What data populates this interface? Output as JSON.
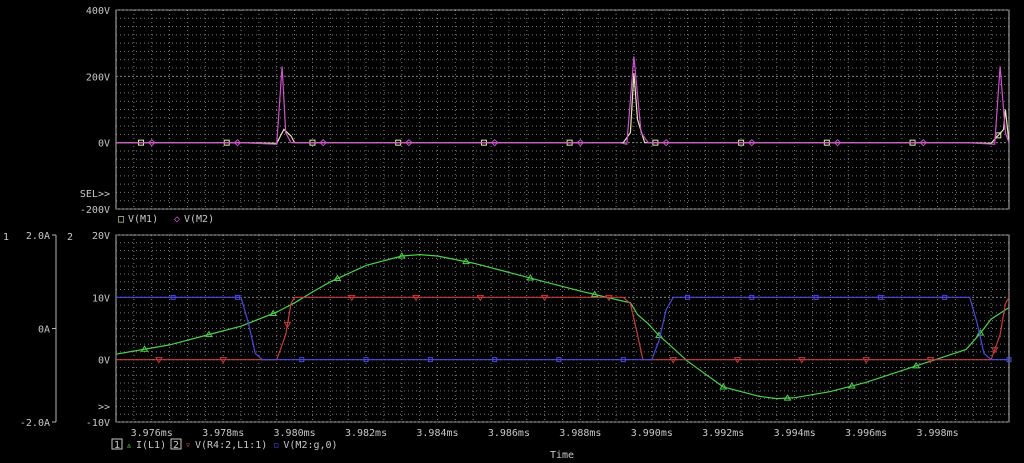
{
  "colors": {
    "background": "#000000",
    "frame": "#b4b4b4",
    "grid": "#7a7a7a",
    "text": "#c8c8c8",
    "v_m1": "#e8e6b0",
    "v_m2": "#d050d0",
    "i_l1": "#4cd04c",
    "v_r4": "#c83a3a",
    "v_m2g": "#4a4ae0"
  },
  "chart_data": [
    {
      "type": "line",
      "panel": "top",
      "x_range_ms": [
        3.975,
        4.0
      ],
      "ylim": [
        -200,
        400
      ],
      "y_ticks": [
        "400V",
        "200V",
        "0V",
        "-200V"
      ],
      "grid": true,
      "sel_marker": "SEL>>",
      "legend": [
        {
          "symbol": "□",
          "label": "V(M1)"
        },
        {
          "symbol": "◇",
          "label": "V(M2)"
        }
      ],
      "series": [
        {
          "name": "V(M1)",
          "x": [
            3.975,
            3.9785,
            3.9795,
            3.9797,
            3.9799,
            3.98,
            3.9892,
            3.9894,
            3.9895,
            3.9896,
            3.9898,
            3.9903,
            3.9988,
            3.9995,
            3.99985,
            3.9999,
            4.0
          ],
          "values": [
            0,
            0,
            -2,
            40,
            20,
            0,
            0,
            30,
            210,
            70,
            0,
            0,
            0,
            -2,
            40,
            100,
            0
          ]
        },
        {
          "name": "V(M2)",
          "x": [
            3.975,
            3.9785,
            3.9795,
            3.97965,
            3.97975,
            3.9799,
            3.98,
            3.9891,
            3.9893,
            3.9895,
            3.9897,
            3.9899,
            3.99,
            3.9988,
            3.9996,
            3.99975,
            3.9999,
            4.0
          ],
          "values": [
            0,
            0,
            -5,
            230,
            30,
            0,
            0,
            0,
            -5,
            260,
            30,
            0,
            0,
            0,
            -5,
            230,
            30,
            0
          ]
        }
      ]
    },
    {
      "type": "line",
      "panel": "bottom",
      "x_range_ms": [
        3.975,
        4.0
      ],
      "x_ticks": [
        "3.976ms",
        "3.978ms",
        "3.980ms",
        "3.982ms",
        "3.984ms",
        "3.986ms",
        "3.988ms",
        "3.990ms",
        "3.992ms",
        "3.994ms",
        "3.996ms",
        "3.998ms"
      ],
      "xlabel": "Time",
      "axis1": {
        "id": "1",
        "ylim": [
          -2.0,
          2.0
        ],
        "ticks": [
          "2.0A",
          "0A",
          "-2.0A"
        ]
      },
      "axis2": {
        "id": "2",
        "ylim": [
          -10,
          20
        ],
        "ticks": [
          "20V",
          "10V",
          "0V",
          "-10V"
        ]
      },
      "grid": true,
      "sel_marker": ">>",
      "legend": [
        {
          "box": "1",
          "symbol": "▵",
          "label": "I(L1)"
        },
        {
          "box": "2",
          "symbol": "▿",
          "label": "V(R4:2,L1:1)"
        },
        {
          "symbol": "▫",
          "label": "V(M2:g,0)"
        }
      ],
      "series": [
        {
          "name": "I(L1)",
          "axis": "1",
          "x": [
            3.975,
            3.9765,
            3.9775,
            3.9785,
            3.9795,
            3.98,
            3.9805,
            3.981,
            3.982,
            3.983,
            3.9835,
            3.984,
            3.985,
            3.986,
            3.987,
            3.988,
            3.989,
            3.9894,
            3.9896,
            3.9899,
            3.9902,
            3.9905,
            3.991,
            3.992,
            3.993,
            3.9935,
            3.994,
            3.995,
            3.996,
            3.997,
            3.998,
            3.9988,
            3.9992,
            3.9995,
            4.0
          ],
          "values": [
            -0.55,
            -0.35,
            -0.15,
            0.05,
            0.35,
            0.55,
            0.78,
            1.0,
            1.35,
            1.55,
            1.58,
            1.55,
            1.4,
            1.2,
            1.0,
            0.8,
            0.62,
            0.55,
            0.3,
            0.1,
            -0.15,
            -0.35,
            -0.7,
            -1.25,
            -1.45,
            -1.5,
            -1.48,
            -1.35,
            -1.15,
            -0.9,
            -0.65,
            -0.45,
            -0.1,
            0.2,
            0.45
          ]
        },
        {
          "name": "V(R4:2,L1:1)",
          "axis": "2",
          "x": [
            3.975,
            3.9795,
            3.97975,
            3.9799,
            3.98,
            3.9892,
            3.9894,
            3.9896,
            3.98975,
            3.9899,
            3.9995,
            3.99975,
            3.9999,
            4.0
          ],
          "values": [
            0,
            0,
            4,
            9,
            10,
            10,
            9,
            4,
            0,
            0,
            0,
            4,
            9,
            10
          ]
        },
        {
          "name": "V(M2:g,0)",
          "axis": "2",
          "x": [
            3.975,
            3.9785,
            3.9787,
            3.9789,
            3.9791,
            3.99,
            3.9902,
            3.9904,
            3.9906,
            3.9989,
            3.9991,
            3.9993,
            3.9995,
            4.0
          ],
          "values": [
            10,
            10,
            6,
            1,
            0,
            0,
            3,
            8,
            10,
            10,
            6,
            1,
            0,
            0
          ]
        }
      ]
    }
  ]
}
